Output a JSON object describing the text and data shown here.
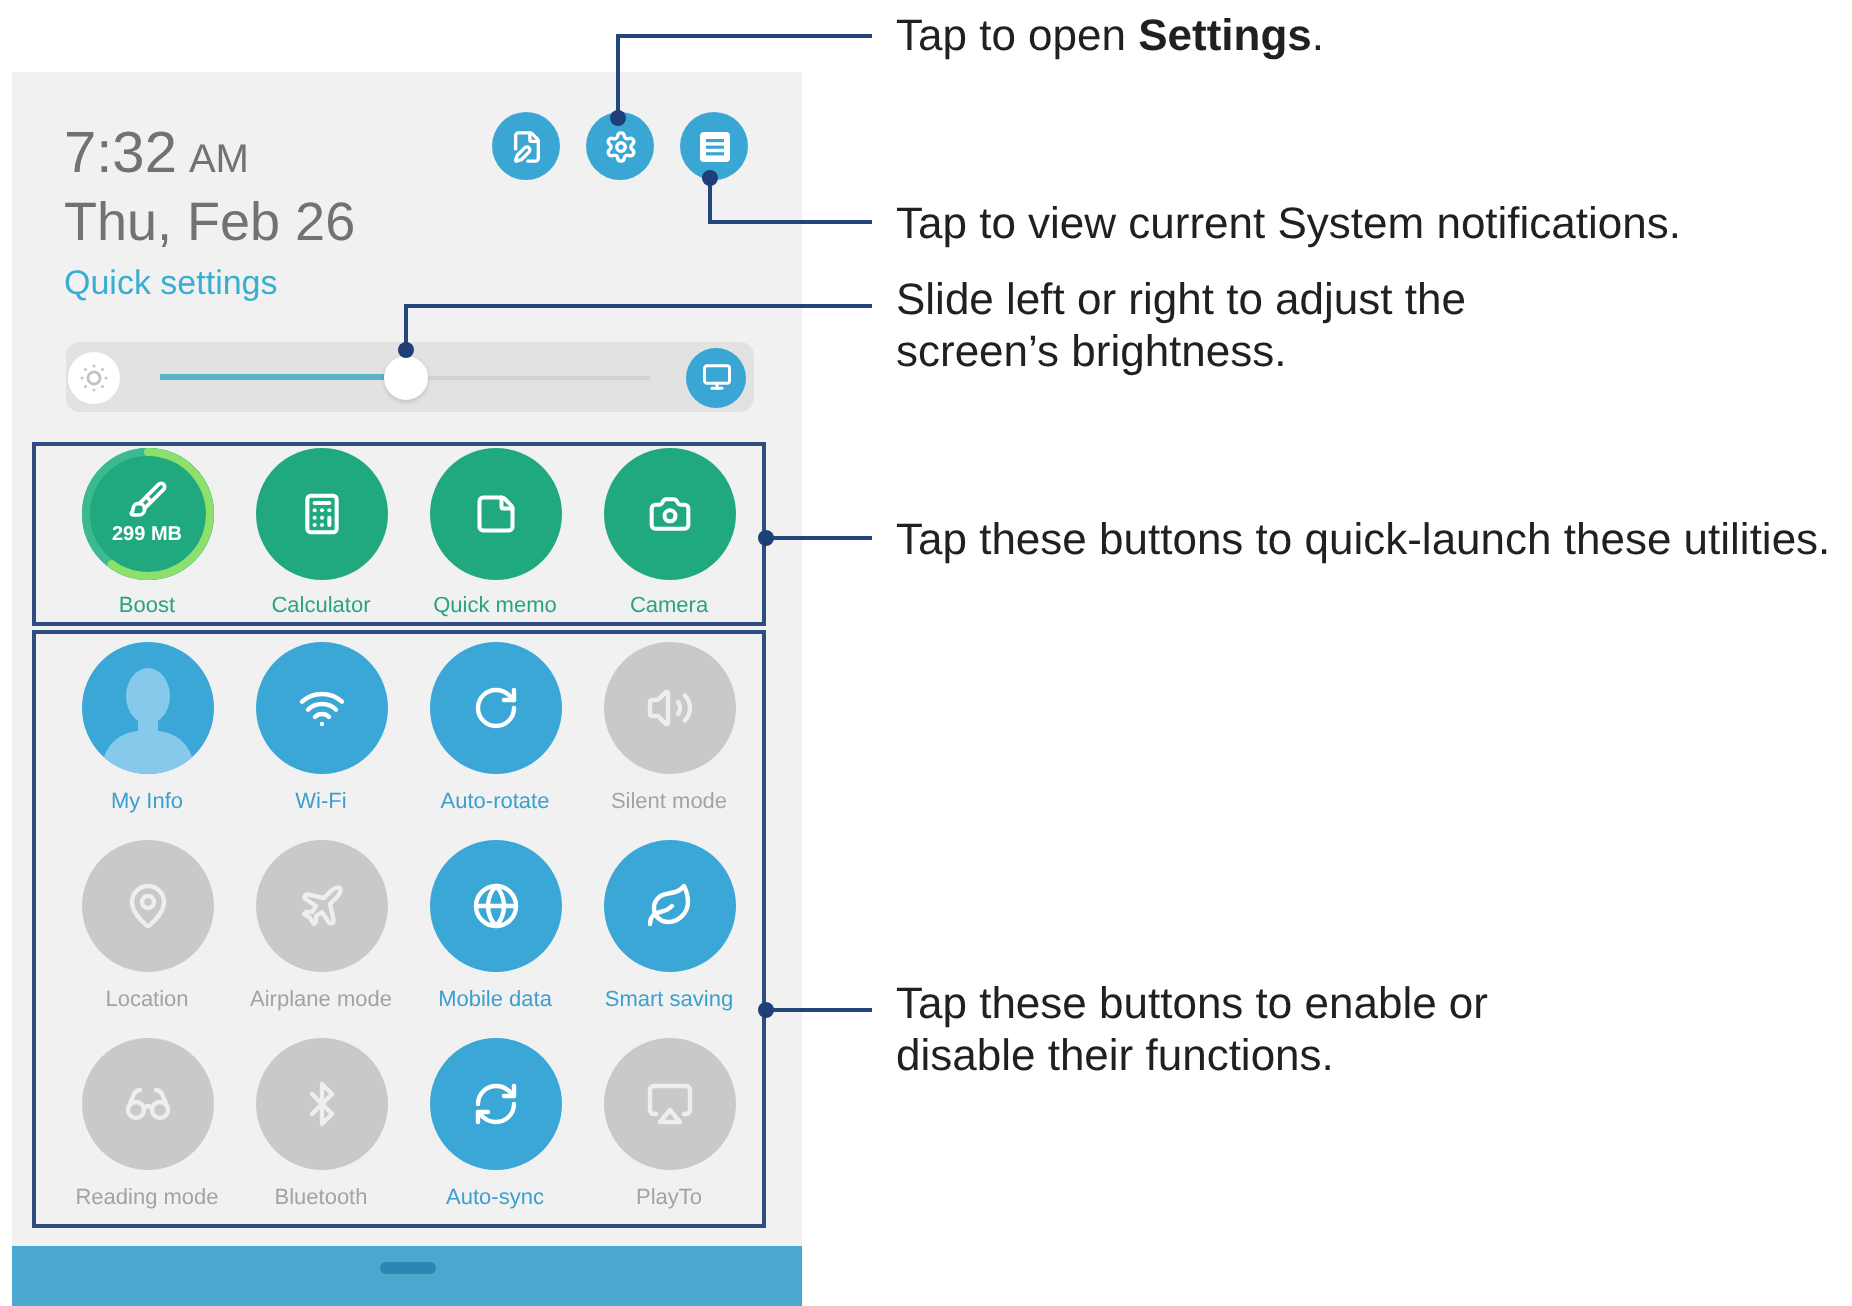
{
  "status": {
    "time": "7:32",
    "meridiem": "AM",
    "date": "Thu, Feb 26",
    "section_title": "Quick settings"
  },
  "brightness": {
    "level": 0.5
  },
  "utilities": [
    {
      "kind": "boost",
      "label": "Boost",
      "reading": "299 MB"
    },
    {
      "kind": "calculator",
      "label": "Calculator"
    },
    {
      "kind": "quick_memo",
      "label": "Quick memo"
    },
    {
      "kind": "camera",
      "label": "Camera"
    }
  ],
  "toggles": [
    {
      "kind": "my_info",
      "label": "My Info",
      "on": true
    },
    {
      "kind": "wifi",
      "label": "Wi-Fi",
      "on": true
    },
    {
      "kind": "auto_rotate",
      "label": "Auto-rotate",
      "on": true
    },
    {
      "kind": "silent_mode",
      "label": "Silent mode",
      "on": false
    },
    {
      "kind": "location",
      "label": "Location",
      "on": false
    },
    {
      "kind": "airplane_mode",
      "label": "Airplane mode",
      "on": false
    },
    {
      "kind": "mobile_data",
      "label": "Mobile data",
      "on": true
    },
    {
      "kind": "smart_saving",
      "label": "Smart saving",
      "on": true
    },
    {
      "kind": "reading_mode",
      "label": "Reading mode",
      "on": false
    },
    {
      "kind": "bluetooth",
      "label": "Bluetooth",
      "on": false
    },
    {
      "kind": "auto_sync",
      "label": "Auto-sync",
      "on": true
    },
    {
      "kind": "play_to",
      "label": "PlayTo",
      "on": false
    }
  ],
  "callouts": [
    {
      "text": "Tap to open **Settings**."
    },
    {
      "text": "Tap to view current System notifications."
    },
    {
      "text": "Slide left or right to adjust the\nscreen’s brightness."
    },
    {
      "text": "Tap these buttons to quick-launch these utilities."
    },
    {
      "text": "Tap these buttons to enable or\ndisable their functions."
    }
  ]
}
